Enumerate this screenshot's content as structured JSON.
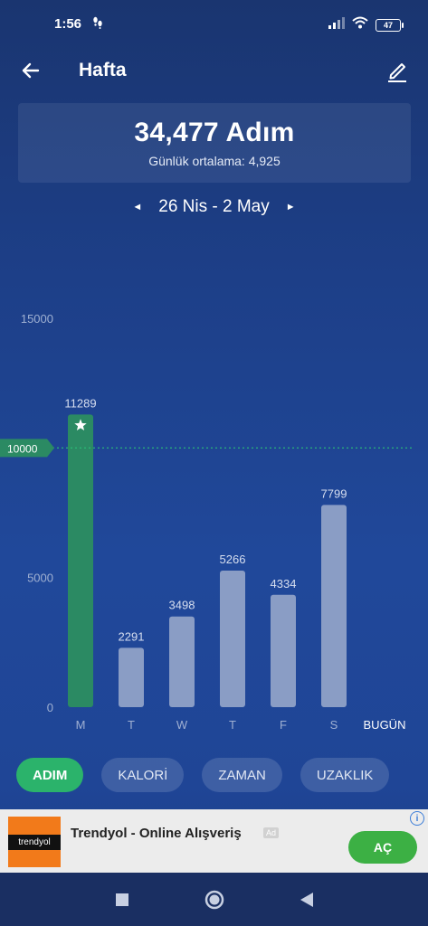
{
  "status": {
    "time": "1:56",
    "battery": "47"
  },
  "header": {
    "title": "Hafta"
  },
  "summary": {
    "total": "34,477 Adım",
    "avg_label": "Günlük ortalama:",
    "avg_value": "4,925"
  },
  "date_nav": {
    "range": "26 Nis - 2 May",
    "prev": "◄",
    "next": "►"
  },
  "chart_data": {
    "type": "bar",
    "categories": [
      "M",
      "T",
      "W",
      "T",
      "F",
      "S"
    ],
    "values": [
      11289,
      2291,
      3498,
      5266,
      4334,
      7799
    ],
    "value_labels": [
      "11289",
      "2291",
      "3498",
      "5266",
      "4334",
      "7799"
    ],
    "today_label": "BUGÜN",
    "ylim": [
      0,
      15000
    ],
    "yticks": [
      "0",
      "5000",
      "15000"
    ],
    "goal": 10000,
    "goal_label": "10000",
    "goal_reached_icon": "star-icon",
    "colors": {
      "bar": "#8a9dc5",
      "goal_bar": "#2b8a63",
      "goal_line": "#2bbf7a"
    }
  },
  "tabs": [
    {
      "label": "ADIM",
      "active": true
    },
    {
      "label": "KALORİ",
      "active": false
    },
    {
      "label": "ZAMAN",
      "active": false
    },
    {
      "label": "UZAKLIK",
      "active": false
    }
  ],
  "ad": {
    "brand": "trendyol",
    "title": "Trendyol - Online Alışveriş",
    "badge": "Ad",
    "cta": "AÇ"
  },
  "colors": {
    "accent": "#2bb36b",
    "ad_cta": "#3cb044",
    "brand_orange": "#f27a1a"
  }
}
